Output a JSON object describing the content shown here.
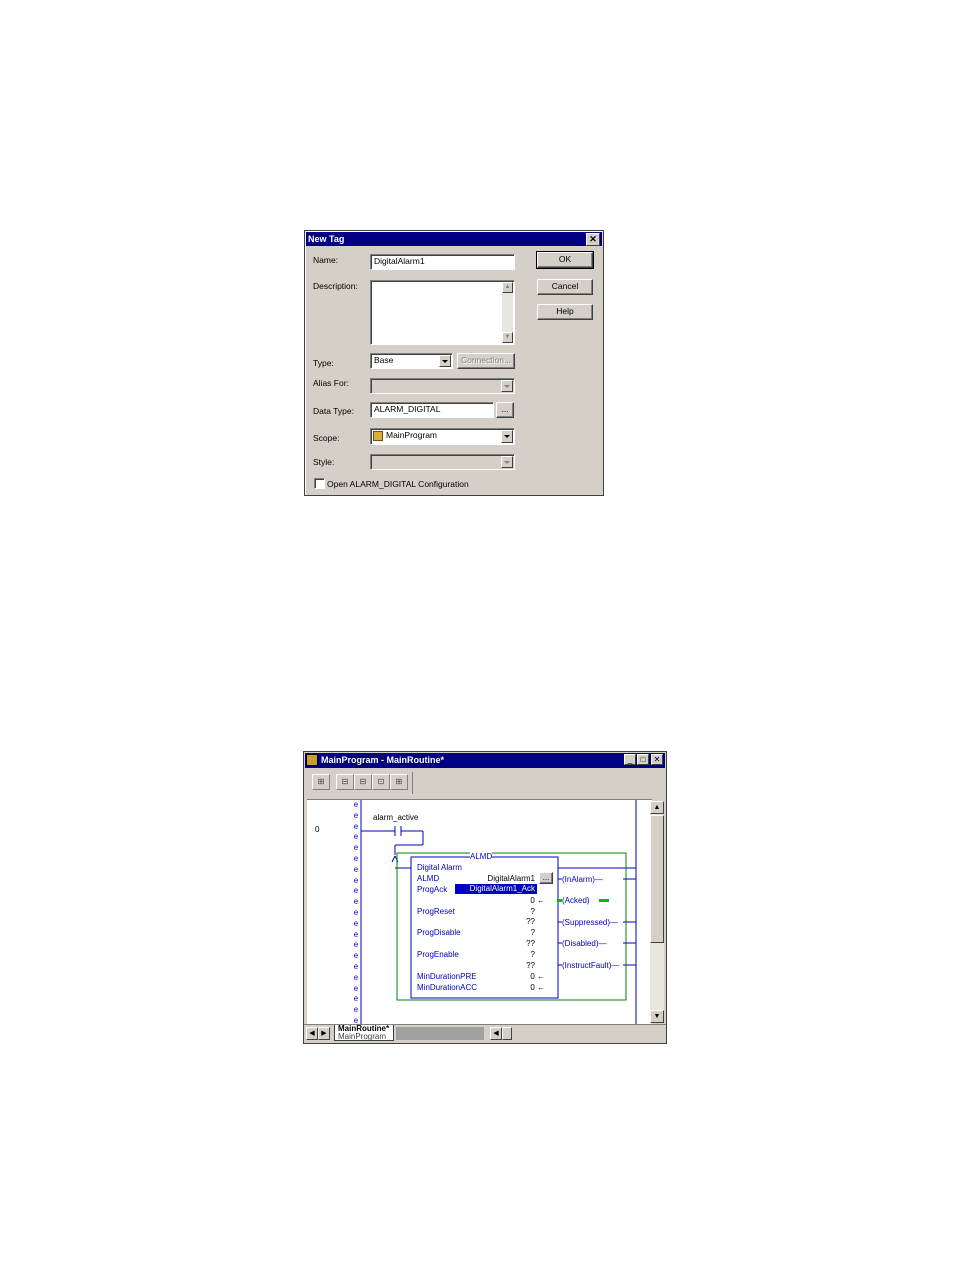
{
  "new_tag_dialog": {
    "title": "New Tag",
    "close_glyph": "✕",
    "name_label": "Name:",
    "name_value": "DigitalAlarm1",
    "description_label": "Description:",
    "description_value": "",
    "type_label": "Type:",
    "type_value": "Base",
    "connection_button": "Connection...",
    "alias_for_label": "Alias For:",
    "alias_for_value": "",
    "data_type_label": "Data Type:",
    "data_type_value": "ALARM_DIGITAL",
    "browse_button": "...",
    "scope_label": "Scope:",
    "scope_value": "MainProgram",
    "style_label": "Style:",
    "style_value": "",
    "open_config_label": "Open ALARM_DIGITAL Configuration",
    "open_config_checked": false,
    "ok_button": "OK",
    "cancel_button": "Cancel",
    "help_button": "Help"
  },
  "routine_window": {
    "title": "MainProgram - MainRoutine*",
    "rung_number": "0",
    "contact_tag": "alarm_active",
    "block_name": "ALMD",
    "block_title": "Digital Alarm",
    "params": [
      {
        "name": "ALMD",
        "value": "DigitalAlarm1"
      },
      {
        "name": "ProgAck",
        "value": "DigitalAlarm1_Ack"
      },
      {
        "name": "",
        "value": "0 ←"
      },
      {
        "name": "ProgReset",
        "value": "?"
      },
      {
        "name": "",
        "value": "??"
      },
      {
        "name": "ProgDisable",
        "value": "?"
      },
      {
        "name": "",
        "value": "??"
      },
      {
        "name": "ProgEnable",
        "value": "?"
      },
      {
        "name": "",
        "value": "??"
      },
      {
        "name": "MinDurationPRE",
        "value": "0 ←"
      },
      {
        "name": "MinDurationACC",
        "value": "0 ←"
      }
    ],
    "outputs": [
      "InAlarm",
      "Acked",
      "Suppressed",
      "Disabled",
      "InstructFault"
    ],
    "tab_label": "MainRoutine*",
    "tab_sublabel": "MainProgram",
    "block_browse": "..."
  },
  "colors": {
    "title_bar": "#000080",
    "ladder_blue": "#0000c0",
    "block_border": "#008000",
    "selection": "#0000c0"
  }
}
